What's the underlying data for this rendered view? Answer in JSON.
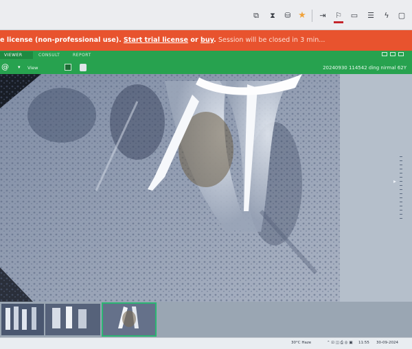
{
  "browser": {
    "toolbar_icons": [
      "screen-share-icon",
      "hourglass-icon",
      "database-icon",
      "star-icon",
      "forward-icon",
      "notification-icon",
      "chat-icon",
      "message-icon",
      "bolt-icon",
      "screen-icon"
    ],
    "star_color": "#f0a23a"
  },
  "license": {
    "prefix": "e license (non-professional use).",
    "trial_link": "Start trial license",
    "or": " or ",
    "buy_link": "buy",
    "buy_suffix": ".",
    "session": " Session will be closed in 3 min..."
  },
  "viewer": {
    "tabs": [
      "VIEWER",
      "CONSULT",
      "REPORT"
    ],
    "active_tab": "VIEWER",
    "view_label": "View",
    "patient_info": "20240930 114542 ding nirmal 62Y"
  },
  "taskbar": {
    "weather": "30°C Haze",
    "time": "11:55",
    "date": "30-09-2024"
  },
  "colors": {
    "banner": "#e8532e",
    "viewer_green": "#27a24f",
    "selected_thumb": "#2bb673"
  }
}
